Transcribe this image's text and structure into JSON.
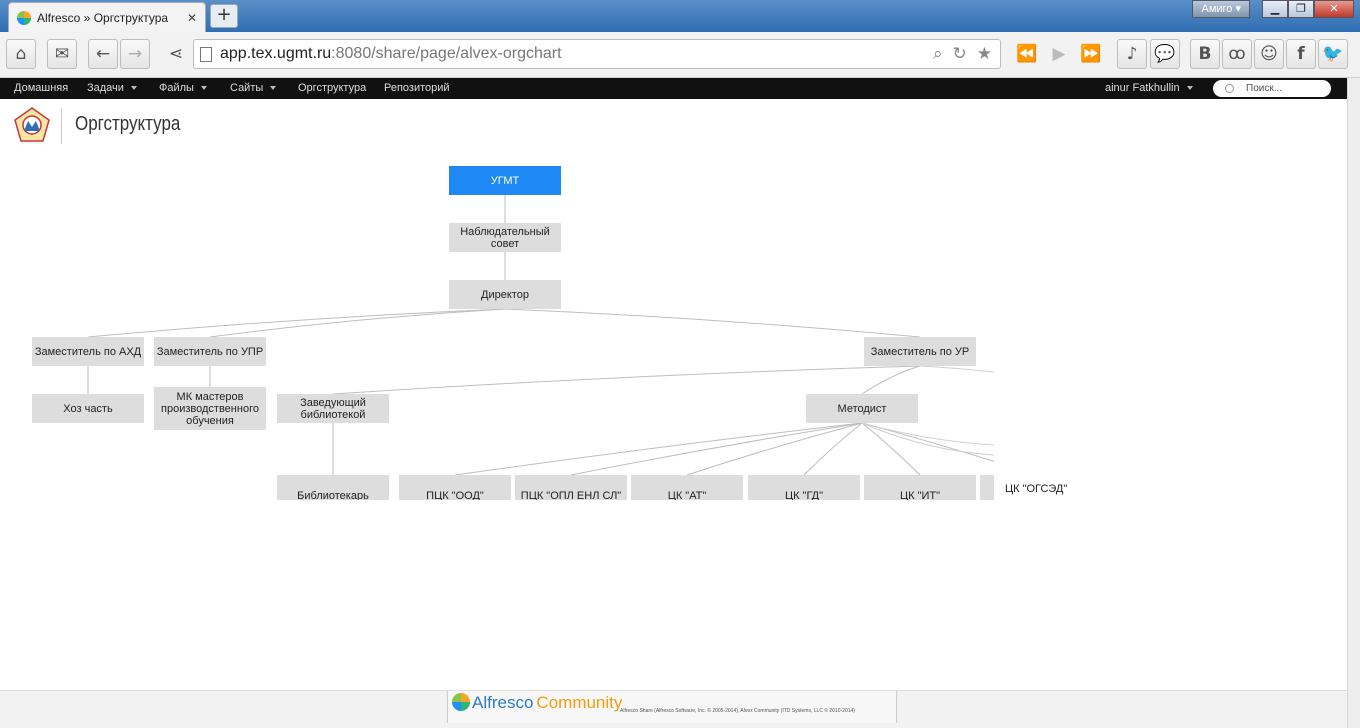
{
  "browser": {
    "tab_title": "Alfresco » Оргструктура",
    "tab_close": "✕",
    "new_tab": "+",
    "brand_menu": "Амиго ▾",
    "url_host": "app.tex.ugmt.ru",
    "url_rest": ":8080/share/page/alvex-orgchart"
  },
  "nav": {
    "items": [
      {
        "label": "Домашняя"
      },
      {
        "label": "Задачи"
      },
      {
        "label": "Файлы"
      },
      {
        "label": "Сайты"
      },
      {
        "label": "Оргструктура"
      },
      {
        "label": "Репозиторий"
      }
    ],
    "user": "ainur Fatkhullin",
    "search_placeholder": "Поиск..."
  },
  "page": {
    "title": "Оргструктура"
  },
  "orgchart": {
    "nodes": [
      {
        "id": "ugmt",
        "label": "УГМТ",
        "root": true
      },
      {
        "id": "board",
        "label": "Наблюдательный совет"
      },
      {
        "id": "director",
        "label": "Директор"
      },
      {
        "id": "dep_ahd",
        "label": "Заместитель по АХД"
      },
      {
        "id": "dep_upr",
        "label": "Заместитель по УПР"
      },
      {
        "id": "dep_ur",
        "label": "Заместитель по УР"
      },
      {
        "id": "hoz",
        "label": "Хоз часть"
      },
      {
        "id": "mk",
        "label": "МК мастеров производственного обучения"
      },
      {
        "id": "lib_head",
        "label": "Заведующий библиотекой"
      },
      {
        "id": "methodist",
        "label": "Методист"
      },
      {
        "id": "librarian",
        "label": "Библиотекарь"
      },
      {
        "id": "pck_ood",
        "label": "ПЦК \"ООД\""
      },
      {
        "id": "pck_opl",
        "label": "ПЦК \"ОПЛ ЕНЛ СЛ\""
      },
      {
        "id": "ck_at",
        "label": "ЦК \"АТ\""
      },
      {
        "id": "ck_gd",
        "label": "ЦК \"ГД\""
      },
      {
        "id": "ck_it",
        "label": "ЦК \"ИТ\""
      },
      {
        "id": "ck_ogsed",
        "label": "ЦК \"ОГСЭД\""
      }
    ],
    "edges": [
      [
        "ugmt",
        "board"
      ],
      [
        "board",
        "director"
      ],
      [
        "director",
        "dep_ahd"
      ],
      [
        "director",
        "dep_upr"
      ],
      [
        "director",
        "dep_ur"
      ],
      [
        "dep_ahd",
        "hoz"
      ],
      [
        "dep_upr",
        "mk"
      ],
      [
        "dep_ur",
        "lib_head"
      ],
      [
        "dep_ur",
        "methodist"
      ],
      [
        "lib_head",
        "librarian"
      ],
      [
        "methodist",
        "pck_ood"
      ],
      [
        "methodist",
        "pck_opl"
      ],
      [
        "methodist",
        "ck_at"
      ],
      [
        "methodist",
        "ck_gd"
      ],
      [
        "methodist",
        "ck_it"
      ],
      [
        "methodist",
        "ck_ogsed"
      ]
    ]
  },
  "footer": {
    "brand_name": "Alfresco",
    "brand_edition": "Community",
    "copyright": "Alfresco Share (Alfresco Software, Inc. © 2005-2014), Alvex Community (ITD Systems, LLC © 2010-2014)"
  }
}
